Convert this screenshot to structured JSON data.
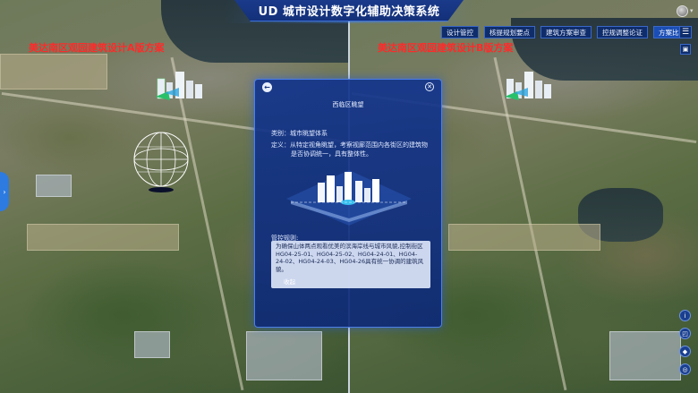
{
  "header": {
    "title": "UD 城市设计数字化辅助决策系统"
  },
  "schemes": {
    "left_title": "美达南区观园建筑设计A版方案",
    "right_title": "美达南区观园建筑设计B版方案"
  },
  "nav": {
    "items": [
      "设计管控",
      "核提规划要点",
      "建筑方案审查",
      "控规调整论证",
      "方案比选"
    ],
    "active_index": 4,
    "menu_icon": "menu-icon"
  },
  "panel": {
    "back_icon": "back-arrow-icon",
    "close_icon": "close-icon",
    "title": "西临区眺望",
    "category_label": "类别：",
    "category_value": "城市眺望体系",
    "definition_label": "定义：",
    "definition_value": "从特定视角眺望，考察视廊范围内各街区的建筑物是否协调统一，具有整体性。",
    "rules_label": "管控规则:",
    "rules_text": "为确保山体两点观看优美的滨海岸线与城市风貌,控制街区HG04-25-01、HG04-25-02、HG04-24-01、HG04-24-02、HG04-24-03、HG04-26具有统一协调的建筑风貌。",
    "collapse_label": "收起"
  },
  "toolbar": {
    "icons": [
      "info-icon",
      "screenshot-icon",
      "layers-icon",
      "locate-icon"
    ]
  },
  "colors": {
    "accent": "#1b4eb5",
    "scheme_title": "#ff2a2a",
    "panel_bg": "#12348c"
  }
}
